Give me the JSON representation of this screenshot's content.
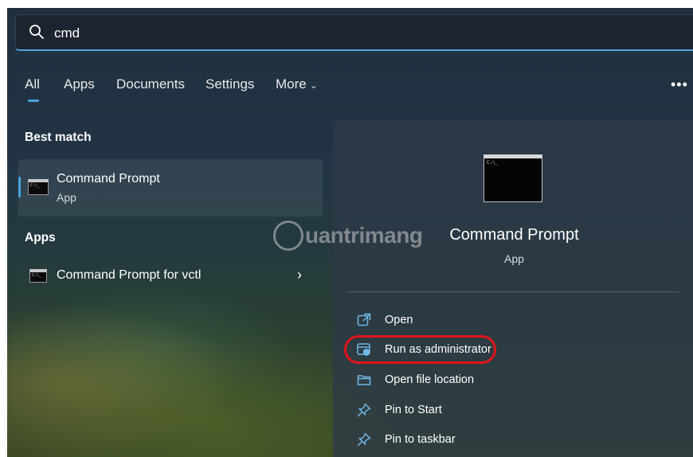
{
  "search": {
    "query": "cmd"
  },
  "tabs": [
    {
      "label": "All",
      "selected": true
    },
    {
      "label": "Apps"
    },
    {
      "label": "Documents"
    },
    {
      "label": "Settings"
    },
    {
      "label": "More"
    }
  ],
  "sections": {
    "best_match": "Best match",
    "apps": "Apps"
  },
  "best_match": {
    "title": "Command Prompt",
    "subtitle": "App"
  },
  "apps_results": [
    {
      "title": "Command Prompt for vctl"
    }
  ],
  "detail": {
    "title": "Command Prompt",
    "subtitle": "App",
    "actions": [
      {
        "label": "Open",
        "icon": "open-external-icon"
      },
      {
        "label": "Run as administrator",
        "icon": "shield-admin-icon"
      },
      {
        "label": "Open file location",
        "icon": "folder-icon"
      },
      {
        "label": "Pin to Start",
        "icon": "pin-icon"
      },
      {
        "label": "Pin to taskbar",
        "icon": "pin-icon"
      }
    ]
  },
  "watermark": {
    "text": "uantrimang"
  },
  "colors": {
    "accent": "#4aa3df",
    "highlight": "#e0141a",
    "icon": "#6fb8ea"
  }
}
